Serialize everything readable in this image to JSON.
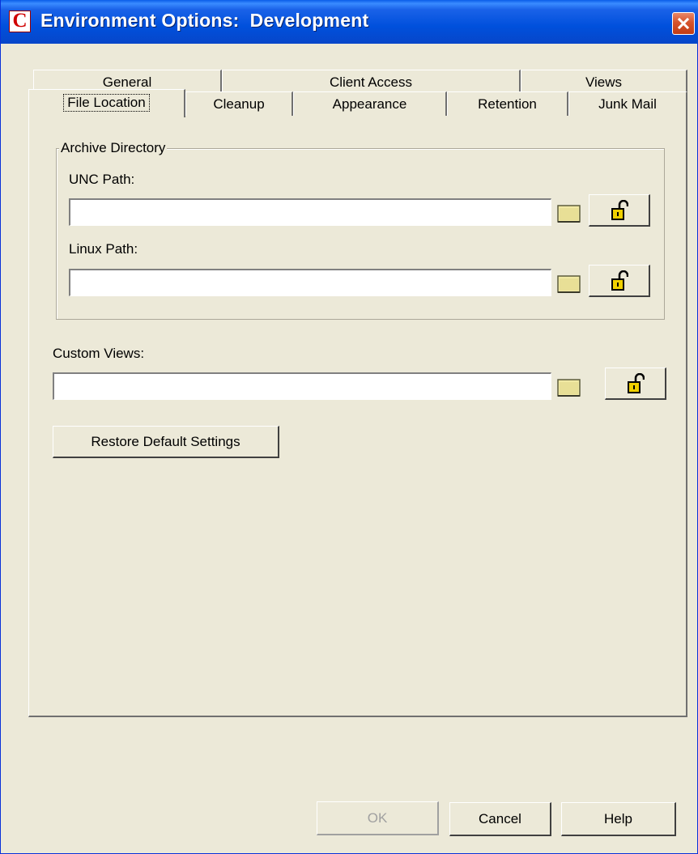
{
  "window": {
    "title": "Environment Options:  Development",
    "app_icon_letter": "C",
    "icons": {
      "app": "app-icon",
      "close": "close-icon"
    },
    "colors": {
      "titlebar": "#0050dc",
      "close": "#d6532c",
      "face": "#ece9d8"
    }
  },
  "tabs": {
    "back_row": [
      {
        "label": "General"
      },
      {
        "label": "Client Access"
      },
      {
        "label": "Views"
      }
    ],
    "front_row": [
      {
        "label": "File Location",
        "selected": true
      },
      {
        "label": "Cleanup"
      },
      {
        "label": "Appearance"
      },
      {
        "label": "Retention"
      },
      {
        "label": "Junk Mail"
      }
    ]
  },
  "archive": {
    "legend": "Archive Directory",
    "unc_label": "UNC Path:",
    "unc_value": "",
    "linux_label": "Linux Path:",
    "linux_value": ""
  },
  "custom_views": {
    "label": "Custom Views:",
    "value": ""
  },
  "restore_button": "Restore Default Settings",
  "buttons": {
    "ok": "OK",
    "cancel": "Cancel",
    "help": "Help"
  },
  "icon_names": [
    "folder-icon",
    "unlock-icon"
  ]
}
